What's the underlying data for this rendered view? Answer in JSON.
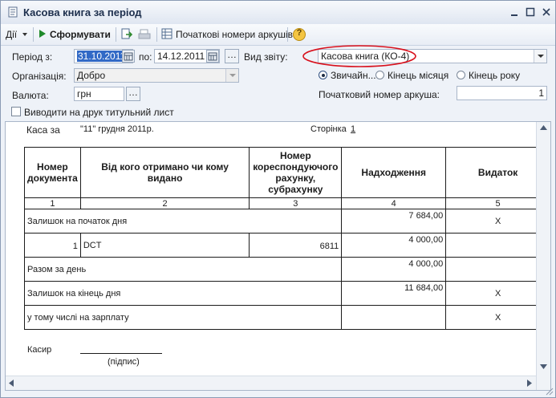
{
  "window": {
    "title": "Касова книга за період"
  },
  "toolbar": {
    "actions_label": "Дії",
    "generate_label": "Сформувати",
    "sheet_numbers_label": "Початкові номери аркушів",
    "help_label": "?"
  },
  "form": {
    "period_label": "Період з:",
    "period_from": "31.10.2011",
    "period_to_label": "по:",
    "period_to": "14.12.2011",
    "report_type_label": "Вид звіту:",
    "report_type_value": "Касова книга (КО-4)",
    "organization_label": "Організація:",
    "organization_value": "Добро",
    "currency_label": "Валюта:",
    "currency_value": "грн",
    "mode_options": [
      "Звичайн...",
      "Кінець місяця",
      "Кінець року"
    ],
    "mode_selected": 0,
    "start_sheet_label": "Початковий номер аркуша:",
    "start_sheet_value": "1",
    "title_sheet_label": "Виводити на друк титульний лист",
    "title_sheet_checked": false
  },
  "report": {
    "heading_left": "Каса за",
    "date_text": "\"11\" грудня 2011р.",
    "page_label": "Сторінка",
    "page_number": "1",
    "columns": [
      "Номер документа",
      "Від кого отримано чи кому видано",
      "Номер кореспондуючого рахунку, субрахунку",
      "Надходження",
      "Видаток"
    ],
    "column_numbers": [
      "1",
      "2",
      "3",
      "4",
      "5"
    ],
    "rows": [
      {
        "doc": "",
        "party": "Залишок на початок дня",
        "account": "",
        "income": "7 684,00",
        "expense": "X",
        "merged": true
      },
      {
        "doc": "1",
        "party": "DCT",
        "account": "6811",
        "income": "4 000,00",
        "expense": "",
        "merged": false
      },
      {
        "doc": "",
        "party": "Разом за день",
        "account": "",
        "income": "4 000,00",
        "expense": "",
        "merged": true
      },
      {
        "doc": "",
        "party": "Залишок на кінець дня",
        "account": "",
        "income": "11 684,00",
        "expense": "X",
        "merged": true
      },
      {
        "doc": "",
        "party": "у тому числі на зарплату",
        "account": "",
        "income": "",
        "expense": "X",
        "merged": true
      }
    ],
    "cashier_label": "Касир",
    "signature_label": "(підпис)"
  }
}
